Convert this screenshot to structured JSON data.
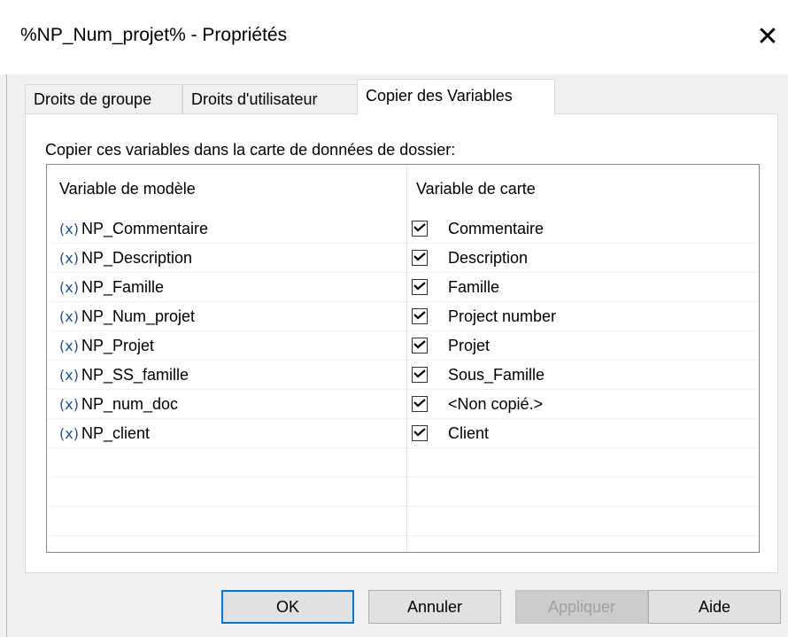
{
  "window": {
    "title": "%NP_Num_projet% - Propriétés",
    "close_symbol": "✕"
  },
  "tabs": [
    {
      "label": "Droits de groupe",
      "active": false
    },
    {
      "label": "Droits d'utilisateur",
      "active": false
    },
    {
      "label": "Copier des Variables",
      "active": true
    }
  ],
  "panel": {
    "label": "Copier ces variables dans la carte de données de dossier:"
  },
  "list": {
    "columns": [
      "Variable de modèle",
      "Variable de carte"
    ],
    "icon_text": "(x)",
    "rows": [
      {
        "template_var": "NP_Commentaire",
        "checked": true,
        "card_var": "Commentaire"
      },
      {
        "template_var": "NP_Description",
        "checked": true,
        "card_var": "Description"
      },
      {
        "template_var": "NP_Famille",
        "checked": true,
        "card_var": "Famille"
      },
      {
        "template_var": "NP_Num_projet",
        "checked": true,
        "card_var": "Project number"
      },
      {
        "template_var": "NP_Projet",
        "checked": true,
        "card_var": "Projet"
      },
      {
        "template_var": "NP_SS_famille",
        "checked": true,
        "card_var": "Sous_Famille"
      },
      {
        "template_var": "NP_num_doc",
        "checked": true,
        "card_var": "<Non copié.>"
      },
      {
        "template_var": "NP_client",
        "checked": true,
        "card_var": "Client"
      }
    ]
  },
  "buttons": {
    "ok": "OK",
    "cancel": "Annuler",
    "apply": "Appliquer",
    "help": "Aide"
  },
  "colors": {
    "accent": "#0078d7",
    "variable_icon": "#1f4e9c"
  }
}
